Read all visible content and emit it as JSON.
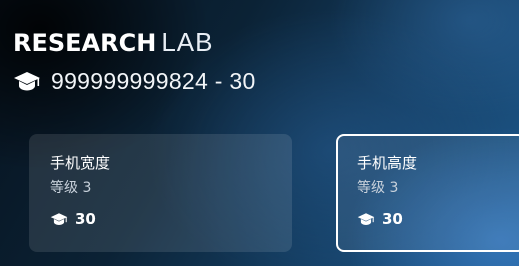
{
  "header": {
    "logo_bold": "RESEARCH",
    "logo_light": "LAB",
    "subtitle_icon": "graduation-cap-icon",
    "subtitle": "999999999824 - 30"
  },
  "cards": [
    {
      "name": "手机宽度",
      "level": "等级 3",
      "cost_icon": "graduation-cap-icon",
      "cost": "30",
      "selected": false
    },
    {
      "name": "手机高度",
      "level": "等级 3",
      "cost_icon": "graduation-cap-icon",
      "cost": "30",
      "selected": true
    }
  ],
  "colors": {
    "background_dark": "#07131f",
    "background_light": "#1e5a8e",
    "text": "#ffffff",
    "card_fill": "rgba(255,255,255,0.11)",
    "selected_border": "#ffffff"
  }
}
